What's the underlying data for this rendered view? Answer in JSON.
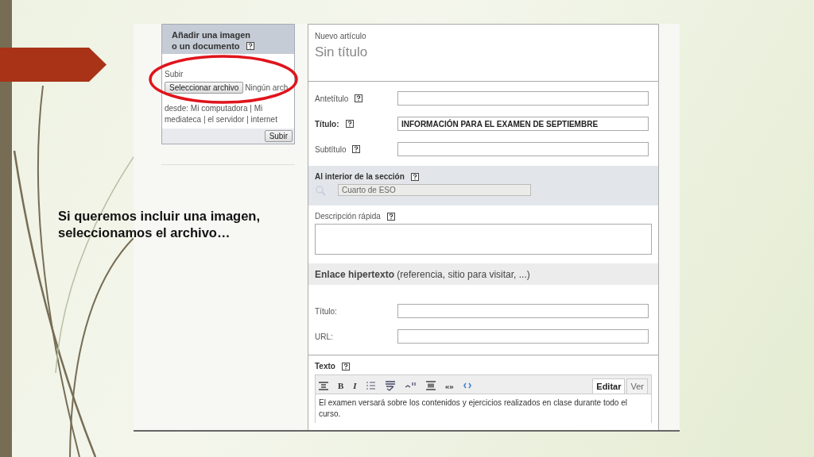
{
  "caption": "Si queremos incluir una imagen, seleccionamos el archivo…",
  "upload_panel": {
    "title_lines": [
      "Añadir una imagen",
      "o un documento"
    ],
    "upload_label": "Subir",
    "file_button": "Seleccionar archivo",
    "file_status": "Ningún arch",
    "source_text": "desde: Mi computadora | Mi mediateca | el servidor | internet",
    "submit_button": "Subir"
  },
  "article": {
    "kicker": "Nuevo artículo",
    "title": "Sin título"
  },
  "top_fields": [
    {
      "label": "Antetítulo",
      "bold": false
    },
    {
      "label": "Título:",
      "bold": true,
      "value": "INFORMACIÓN PARA EL EXAMEN DE SEPTIEMBRE"
    },
    {
      "label": "Subtítulo",
      "bold": false
    }
  ],
  "section": {
    "label": "Al interior de la sección",
    "value": "Cuarto de ESO"
  },
  "description": {
    "label": "Descripción rápida"
  },
  "link": {
    "heading": "**Enlace hipertexto** (referencia, sitio para visitar, ...)",
    "fields": [
      {
        "label": "Título:"
      },
      {
        "label": "URL:"
      }
    ]
  },
  "text": {
    "label": "Texto",
    "toolbar": [
      {
        "kind": "align"
      },
      {
        "kind": "bold",
        "glyph": "B"
      },
      {
        "kind": "italic",
        "glyph": "I"
      },
      {
        "kind": "list"
      },
      {
        "kind": "spell"
      },
      {
        "kind": "note"
      },
      {
        "kind": "block"
      },
      {
        "kind": "quote",
        "glyph": "«»"
      },
      {
        "kind": "code"
      }
    ],
    "tabs": [
      {
        "label": "Editar",
        "selected": true
      },
      {
        "label": "Ver",
        "selected": false
      }
    ],
    "body": "El examen versará sobre los contenidos y ejercicios realizados en clase durante todo el curso."
  }
}
